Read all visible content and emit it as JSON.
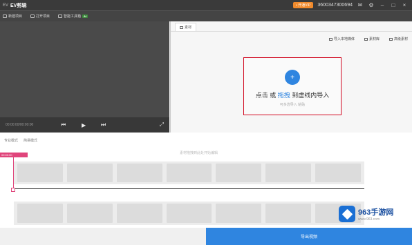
{
  "titlebar": {
    "logo_text": "EV",
    "title": "EV剪辑",
    "vip_label": "• 开通VIP",
    "user_id": "3600347300694",
    "window_buttons": [
      "✉",
      "⚙",
      "–",
      "□",
      "×"
    ]
  },
  "toolbar": {
    "items": [
      {
        "label": "新建项目",
        "icon": "new-project-icon"
      },
      {
        "label": "打开项目",
        "icon": "open-project-icon"
      },
      {
        "label": "智能工具箱",
        "icon": "toolbox-icon"
      }
    ],
    "ai_badge": "AI"
  },
  "preview": {
    "timecode": "00:00:00/00:00:00",
    "prev_icon": "⏮",
    "play_icon": "▶",
    "next_icon": "⏭",
    "fullscreen_icon": "⤢"
  },
  "media": {
    "tab_label": "素材",
    "actions": [
      {
        "label": "导入本地媒体",
        "icon": "import-local-icon"
      },
      {
        "label": "素材库",
        "icon": "library-icon"
      },
      {
        "label": "高级素材",
        "icon": "premium-icon"
      }
    ],
    "import_icon": "+",
    "import_prefix": "点击",
    "import_middle": " 或 ",
    "import_drag": "拖拽",
    "import_suffix": " 到虚线内导入",
    "import_sub": "可多选导入    粘贴"
  },
  "timeline": {
    "tabs": [
      "专业模式",
      "简易模式"
    ],
    "hint": "素材拖拽到此处开始编辑",
    "playhead_time": "00:00:00"
  },
  "bottom": {
    "export_label": "导出视频"
  },
  "watermark": {
    "name": "963手游网",
    "url": "www.963.com"
  }
}
